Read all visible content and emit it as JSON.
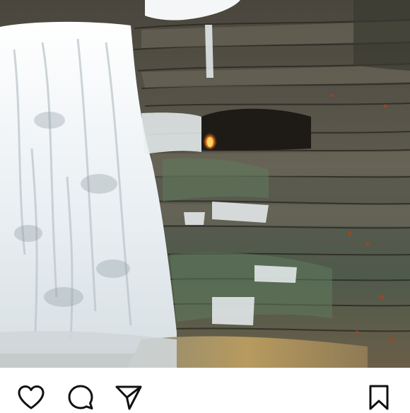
{
  "post": {
    "photo_subject": "",
    "actions": [
      {
        "icon": "heart-icon"
      },
      {
        "icon": "comment-icon"
      },
      {
        "icon": "share-icon"
      },
      {
        "icon": "bookmark-icon"
      }
    ]
  },
  "colors": {
    "background": "#ffffff",
    "icon": "#111111",
    "rock_dark": "#3d3a33",
    "rock_mid": "#6b6757",
    "moss": "#5f7a5c",
    "water": "#f2f4f5",
    "flame": "#f08a1c"
  }
}
